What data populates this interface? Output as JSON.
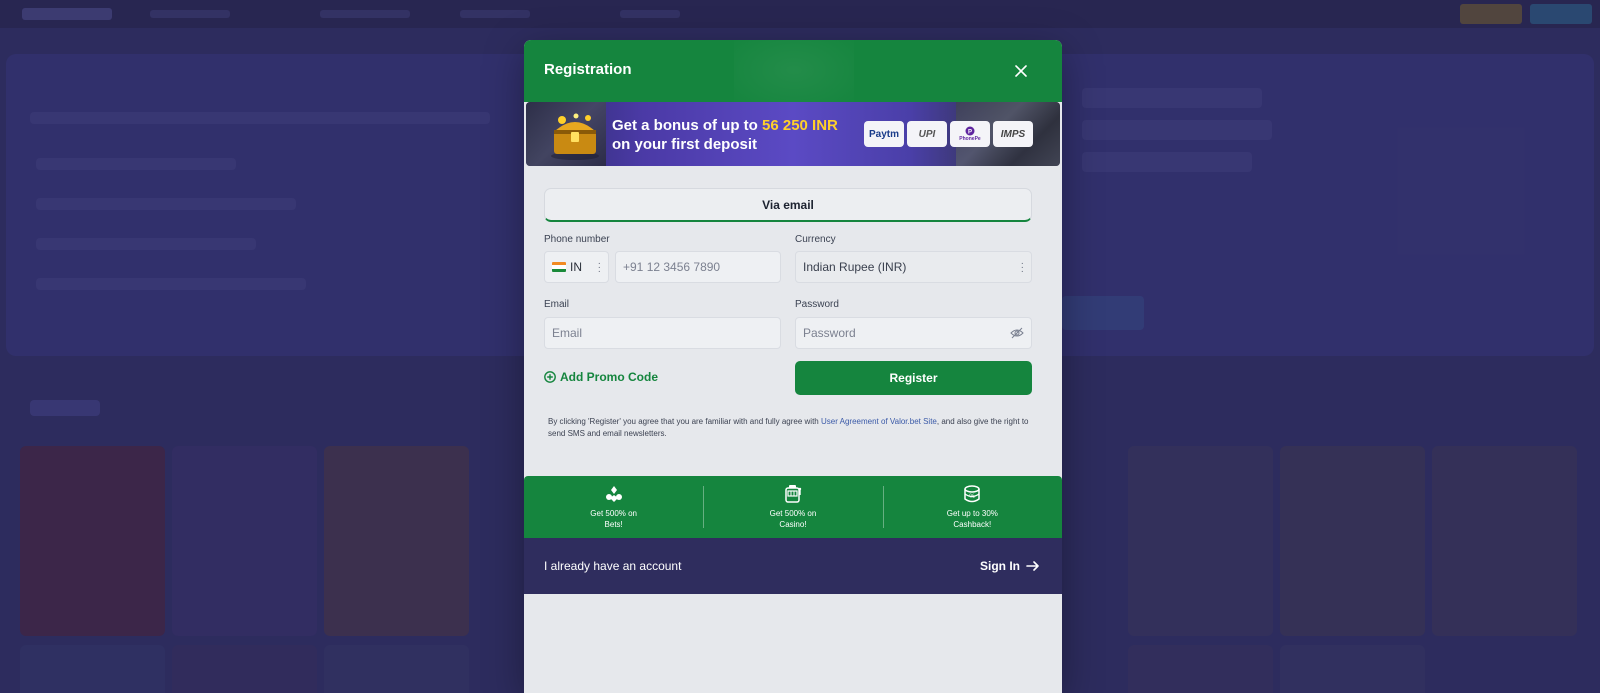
{
  "modal": {
    "title": "Registration",
    "close_icon": "close-icon"
  },
  "banner": {
    "line1_prefix": "Get a bonus of up to ",
    "amount": "56 250 INR",
    "line2": "on your first deposit",
    "payment_methods": [
      "Paytm",
      "UPI",
      "PhonePe",
      "IMPS"
    ]
  },
  "tabs": {
    "email_label": "Via email"
  },
  "form": {
    "phone_label": "Phone number",
    "country_code": "IN",
    "phone_placeholder": "+91 12 3456 7890",
    "currency_label": "Currency",
    "currency_value": "Indian Rupee (INR)",
    "email_label": "Email",
    "email_placeholder": "Email",
    "password_label": "Password",
    "password_placeholder": "Password",
    "promo_label": "Add Promo Code",
    "register_label": "Register"
  },
  "terms": {
    "before": "By clicking 'Register' you agree that you are familiar with and fully agree with ",
    "link": "User Agreement of Valor.bet Site",
    "after": ", and also give the right to send SMS and email newsletters."
  },
  "benefits": [
    {
      "icon": "card-suits-icon",
      "text": "Get 500% on Bets!"
    },
    {
      "icon": "slot-machine-icon",
      "text": "Get 500% on Casino!"
    },
    {
      "icon": "cashback-icon",
      "text": "Get up to 30% Cashback!"
    }
  ],
  "footer": {
    "text": "I already have an account",
    "signin_label": "Sign In"
  },
  "colors": {
    "brand_green": "#15853e",
    "bonus_yellow": "#ffd02a",
    "footer_bg": "#2f2d5e"
  }
}
